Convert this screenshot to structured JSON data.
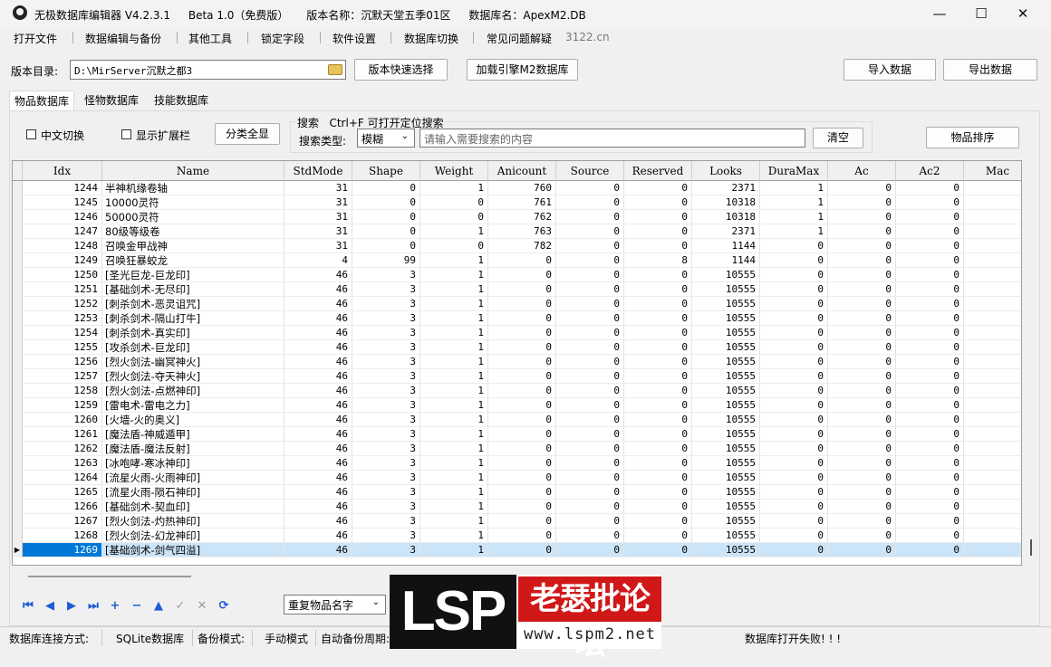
{
  "titlebar": {
    "title": "无极数据库编辑器 V4.2.3.1",
    "edition": "Beta 1.0（免费版）",
    "version_name": "版本名称：沉默天堂五季01区",
    "db_name": "数据库名：ApexM2.DB",
    "minimize": "—",
    "maximize": "☐",
    "close": "✕"
  },
  "menu": [
    "打开文件",
    "数据编辑与备份",
    "其他工具",
    "锁定字段",
    "软件设置",
    "数据库切换",
    "常见问题解疑"
  ],
  "menu_site": "3122.cn",
  "path": {
    "label": "版本目录:",
    "value": "D:\\MirServer沉默之都3",
    "quick_select": "版本快速选择",
    "load_engine": "加载引擎M2数据库",
    "import": "导入数据",
    "export": "导出数据"
  },
  "tabs": [
    "物品数据库",
    "怪物数据库",
    "技能数据库"
  ],
  "options": {
    "chinese_switch": "中文切换",
    "show_ext": "显示扩展栏",
    "category_all": "分类全显",
    "search_title": "搜索",
    "search_hint": "Ctrl+F 可打开定位搜索",
    "search_type_label": "搜索类型:",
    "search_type_value": "模糊",
    "search_placeholder": "请输入需要搜索的内容",
    "clear": "清空",
    "sort": "物品排序"
  },
  "grid": {
    "columns": [
      "Idx",
      "Name",
      "StdMode",
      "Shape",
      "Weight",
      "Anicount",
      "Source",
      "Reserved",
      "Looks",
      "DuraMax",
      "Ac",
      "Ac2",
      "Mac"
    ],
    "rows": [
      [
        "1244",
        "半神机缘卷轴",
        "31",
        "0",
        "1",
        "760",
        "0",
        "0",
        "2371",
        "1",
        "0",
        "0",
        "0"
      ],
      [
        "1245",
        "10000灵符",
        "31",
        "0",
        "0",
        "761",
        "0",
        "0",
        "10318",
        "1",
        "0",
        "0",
        "0"
      ],
      [
        "1246",
        "50000灵符",
        "31",
        "0",
        "0",
        "762",
        "0",
        "0",
        "10318",
        "1",
        "0",
        "0",
        "0"
      ],
      [
        "1247",
        "80级等级卷",
        "31",
        "0",
        "1",
        "763",
        "0",
        "0",
        "2371",
        "1",
        "0",
        "0",
        "0"
      ],
      [
        "1248",
        "召唤金甲战神",
        "31",
        "0",
        "0",
        "782",
        "0",
        "0",
        "1144",
        "0",
        "0",
        "0",
        "0"
      ],
      [
        "1249",
        "召唤狂暴蛟龙",
        "4",
        "99",
        "1",
        "0",
        "0",
        "8",
        "1144",
        "0",
        "0",
        "0",
        "0"
      ],
      [
        "1250",
        "[圣光巨龙-巨龙印]",
        "46",
        "3",
        "1",
        "0",
        "0",
        "0",
        "10555",
        "0",
        "0",
        "0",
        "0"
      ],
      [
        "1251",
        "[基础剑术-无尽印]",
        "46",
        "3",
        "1",
        "0",
        "0",
        "0",
        "10555",
        "0",
        "0",
        "0",
        "0"
      ],
      [
        "1252",
        "[刺杀剑术-恶灵诅咒]",
        "46",
        "3",
        "1",
        "0",
        "0",
        "0",
        "10555",
        "0",
        "0",
        "0",
        "0"
      ],
      [
        "1253",
        "[刺杀剑术-隔山打牛]",
        "46",
        "3",
        "1",
        "0",
        "0",
        "0",
        "10555",
        "0",
        "0",
        "0",
        "0"
      ],
      [
        "1254",
        "[刺杀剑术-真实印]",
        "46",
        "3",
        "1",
        "0",
        "0",
        "0",
        "10555",
        "0",
        "0",
        "0",
        "0"
      ],
      [
        "1255",
        "[攻杀剑术-巨龙印]",
        "46",
        "3",
        "1",
        "0",
        "0",
        "0",
        "10555",
        "0",
        "0",
        "0",
        "0"
      ],
      [
        "1256",
        "[烈火剑法-幽冥神火]",
        "46",
        "3",
        "1",
        "0",
        "0",
        "0",
        "10555",
        "0",
        "0",
        "0",
        "0"
      ],
      [
        "1257",
        "[烈火剑法-夺天神火]",
        "46",
        "3",
        "1",
        "0",
        "0",
        "0",
        "10555",
        "0",
        "0",
        "0",
        "0"
      ],
      [
        "1258",
        "[烈火剑法-点燃神印]",
        "46",
        "3",
        "1",
        "0",
        "0",
        "0",
        "10555",
        "0",
        "0",
        "0",
        "0"
      ],
      [
        "1259",
        "[雷电术-雷电之力]",
        "46",
        "3",
        "1",
        "0",
        "0",
        "0",
        "10555",
        "0",
        "0",
        "0",
        "0"
      ],
      [
        "1260",
        "[火墙-火的奥义]",
        "46",
        "3",
        "1",
        "0",
        "0",
        "0",
        "10555",
        "0",
        "0",
        "0",
        "0"
      ],
      [
        "1261",
        "[魔法盾-神威遁甲]",
        "46",
        "3",
        "1",
        "0",
        "0",
        "0",
        "10555",
        "0",
        "0",
        "0",
        "0"
      ],
      [
        "1262",
        "[魔法盾-魔法反射]",
        "46",
        "3",
        "1",
        "0",
        "0",
        "0",
        "10555",
        "0",
        "0",
        "0",
        "0"
      ],
      [
        "1263",
        "[冰咆哮-寒冰神印]",
        "46",
        "3",
        "1",
        "0",
        "0",
        "0",
        "10555",
        "0",
        "0",
        "0",
        "0"
      ],
      [
        "1264",
        "[流星火雨-火雨神印]",
        "46",
        "3",
        "1",
        "0",
        "0",
        "0",
        "10555",
        "0",
        "0",
        "0",
        "0"
      ],
      [
        "1265",
        "[流星火雨-陨石神印]",
        "46",
        "3",
        "1",
        "0",
        "0",
        "0",
        "10555",
        "0",
        "0",
        "0",
        "0"
      ],
      [
        "1266",
        "[基础剑术-契血印]",
        "46",
        "3",
        "1",
        "0",
        "0",
        "0",
        "10555",
        "0",
        "0",
        "0",
        "0"
      ],
      [
        "1267",
        "[烈火剑法-灼热神印]",
        "46",
        "3",
        "1",
        "0",
        "0",
        "0",
        "10555",
        "0",
        "0",
        "0",
        "0"
      ],
      [
        "1268",
        "[烈火剑法-幻龙神印]",
        "46",
        "3",
        "1",
        "0",
        "0",
        "0",
        "10555",
        "0",
        "0",
        "0",
        "0"
      ],
      [
        "1269",
        "[基础剑术-剑气四溢]",
        "46",
        "3",
        "1",
        "0",
        "0",
        "0",
        "10555",
        "0",
        "0",
        "0",
        "0"
      ]
    ],
    "selected_row": 25
  },
  "bottom": {
    "nav_icons": [
      "first-icon",
      "prior-icon",
      "next-icon",
      "last-icon",
      "insert-icon",
      "delete-icon",
      "edit-icon",
      "post-icon",
      "cancel-icon",
      "refresh-icon"
    ],
    "nav_glyphs": [
      "⏮",
      "◀",
      "▶",
      "⏭",
      "+",
      "−",
      "▲",
      "✓",
      "✕",
      "⟳"
    ],
    "dup_select": "重复物品名字"
  },
  "status": {
    "conn_label": "数据库连接方式:",
    "conn_value": "SQLite数据库",
    "backup_label": "备份模式:",
    "backup_value": "手动模式",
    "auto_backup": "自动备份周期:",
    "message": "数据库打开失败! ! !"
  },
  "watermark": {
    "big": "LSP",
    "cn": "老瑟批论坛",
    "url": "www.lspm2.net"
  }
}
